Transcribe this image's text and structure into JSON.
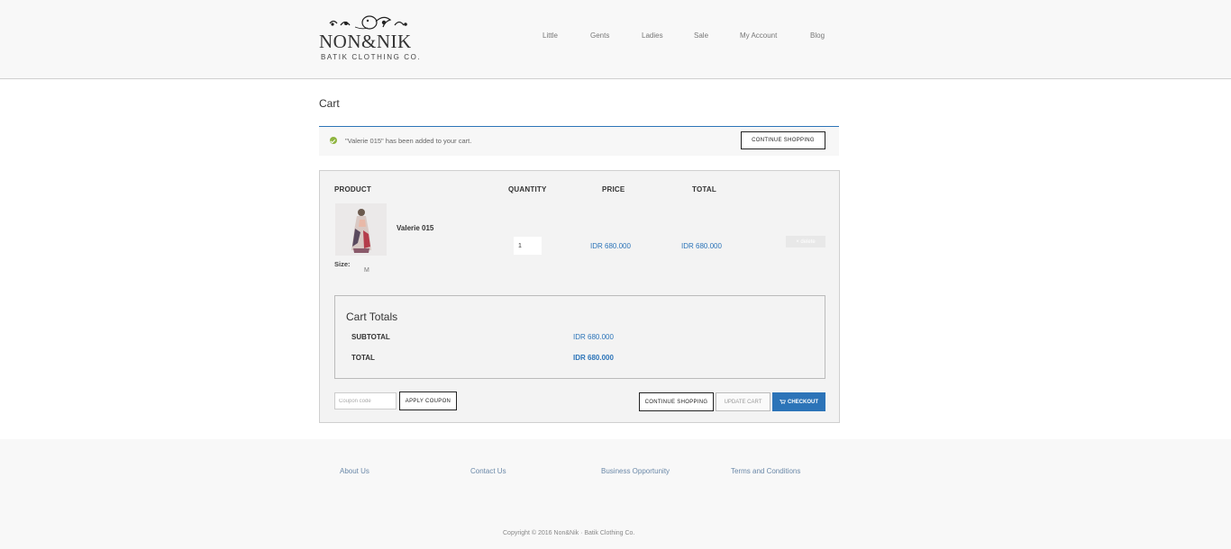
{
  "header": {
    "logo_text": "NON&NIK",
    "logo_subtitle": "BATIK CLOTHING CO.",
    "nav": [
      "Little",
      "Gents",
      "Ladies",
      "Sale",
      "My Account",
      "Blog"
    ]
  },
  "page": {
    "title": "Cart"
  },
  "notice": {
    "message": "\"Valerie 015\" has been added to your cart.",
    "button": "CONTINUE SHOPPING",
    "icon": "check-circle-icon"
  },
  "cart": {
    "columns": [
      "PRODUCT",
      "QUANTITY",
      "PRICE",
      "TOTAL"
    ],
    "items": [
      {
        "name": "Valerie 015",
        "size_label": "Size:",
        "size": "M",
        "quantity": "1",
        "price": "IDR 680.000",
        "total": "IDR 680.000",
        "delete_label": "× delete"
      }
    ]
  },
  "totals": {
    "title": "Cart Totals",
    "subtotal_label": "SUBTOTAL",
    "subtotal": "IDR 680.000",
    "total_label": "TOTAL",
    "total": "IDR 680.000"
  },
  "actions": {
    "coupon_placeholder": "Coupon code",
    "apply_coupon": "APPLY COUPON",
    "continue_shopping": "CONTINUE SHOPPING",
    "update_cart": "UPDATE CART",
    "checkout": "CHECKOUT"
  },
  "footer": {
    "links": [
      "About Us",
      "Contact Us",
      "Business Opportunity",
      "Terms and Conditions"
    ],
    "copyright": "Copyright © 2016 Non&Nik · Batik Clothing Co."
  },
  "colors": {
    "accent": "#2c74b8",
    "success": "#8fb540",
    "header_bg": "#f8f8f8",
    "box_bg": "#f3f3f3"
  }
}
